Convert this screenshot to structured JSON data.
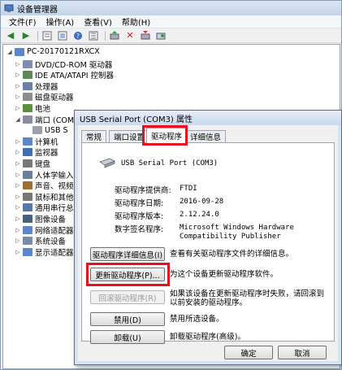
{
  "window": {
    "title": "设备管理器"
  },
  "menu": [
    "文件(F)",
    "操作(A)",
    "查看(V)",
    "帮助(H)"
  ],
  "toolbar_icons": [
    "back-arrow-icon",
    "forward-arrow-icon",
    "properties-icon",
    "scan-icon",
    "help-icon",
    "details-icon",
    "update-driver-icon",
    "disable-icon",
    "uninstall-icon",
    "scan-hardware-icon"
  ],
  "tree": {
    "root": "PC-20170121RXCX",
    "items": [
      {
        "label": "DVD/CD-ROM 驱动器",
        "icon": "dvd-icon",
        "exp": "▷"
      },
      {
        "label": "IDE ATA/ATAPI 控制器",
        "icon": "ide-icon",
        "exp": "▷"
      },
      {
        "label": "处理器",
        "icon": "cpu-icon",
        "exp": "▷"
      },
      {
        "label": "磁盘驱动器",
        "icon": "disk-icon",
        "exp": "▷"
      },
      {
        "label": "电池",
        "icon": "battery-icon",
        "exp": "▷"
      },
      {
        "label": "端口 (COM 和",
        "icon": "port-icon",
        "exp": "◢"
      },
      {
        "label": "USB S",
        "icon": "usb-port-icon",
        "exp": "",
        "child": true
      },
      {
        "label": "计算机",
        "icon": "computer-icon",
        "exp": "▷"
      },
      {
        "label": "监视器",
        "icon": "monitor-icon",
        "exp": "▷"
      },
      {
        "label": "键盘",
        "icon": "keyboard-icon",
        "exp": "▷"
      },
      {
        "label": "人体学输入",
        "icon": "hid-icon",
        "exp": "▷"
      },
      {
        "label": "声音、视频",
        "icon": "sound-icon",
        "exp": "▷"
      },
      {
        "label": "鼠标和其他",
        "icon": "mouse-icon",
        "exp": "▷"
      },
      {
        "label": "通用串行总",
        "icon": "usb-icon",
        "exp": "▷"
      },
      {
        "label": "图像设备",
        "icon": "camera-icon",
        "exp": "▷"
      },
      {
        "label": "网络适配器",
        "icon": "network-icon",
        "exp": "▷"
      },
      {
        "label": "系统设备",
        "icon": "system-icon",
        "exp": "▷"
      },
      {
        "label": "显示适配器",
        "icon": "display-icon",
        "exp": "▷"
      }
    ]
  },
  "dialog": {
    "title": "USB Serial Port (COM3) 属性",
    "tabs": [
      "常规",
      "端口设置",
      "驱动程序",
      "详细信息"
    ],
    "device_name": "USB Serial Port (COM3)",
    "props": [
      {
        "label": "驱动程序提供商:",
        "value": "FTDI"
      },
      {
        "label": "驱动程序日期:",
        "value": "2016-09-28"
      },
      {
        "label": "驱动程序版本:",
        "value": "2.12.24.0"
      },
      {
        "label": "数字签名程序:",
        "value": "Microsoft Windows Hardware"
      },
      {
        "label": "",
        "value": "Compatibility Publisher"
      }
    ],
    "buttons": [
      {
        "label": "驱动程序详细信息(I)",
        "desc": "查看有关驱动程序文件的详细信息。"
      },
      {
        "label": "更新驱动程序(P)...",
        "desc": "为这个设备更新驱动程序软件。"
      },
      {
        "label": "回滚驱动程序(R)",
        "desc": "如果该设备在更新驱动程序时失败，请回滚到以前安装的驱动程序。"
      },
      {
        "label": "禁用(D)",
        "desc": "禁用所选设备。"
      },
      {
        "label": "卸载(U)",
        "desc": "卸载驱动程序(高级)。"
      }
    ],
    "ok": "确定",
    "cancel": "取消"
  },
  "colors": {
    "highlight": "#e8101e",
    "titlebar": "#c9d8ee"
  }
}
